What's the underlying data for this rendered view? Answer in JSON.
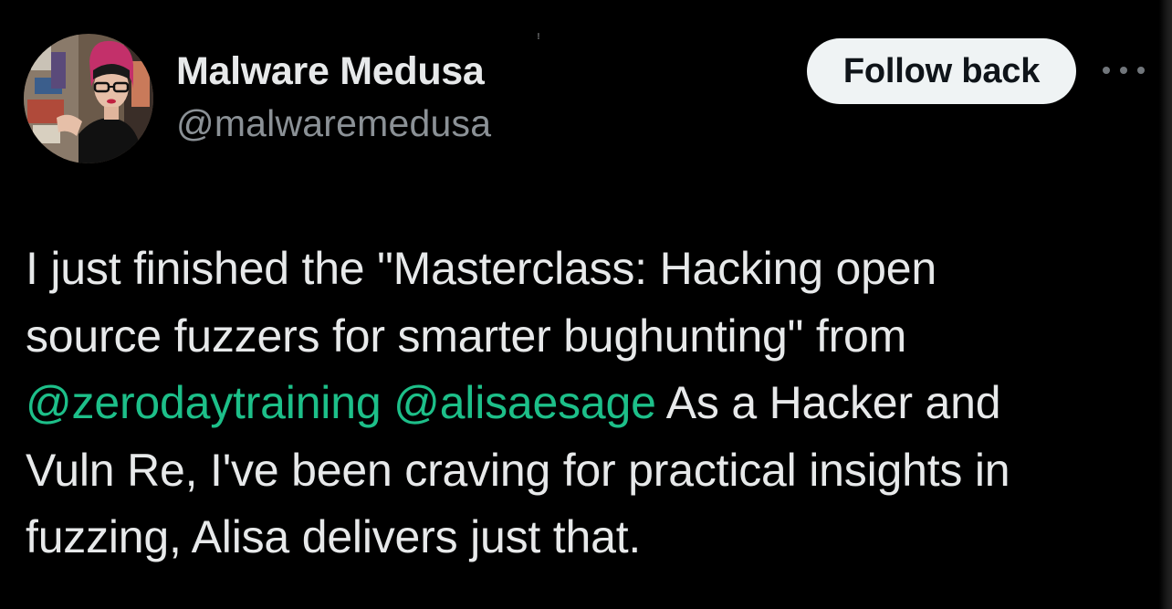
{
  "tweet": {
    "author": {
      "display_name": "Malware Medusa",
      "name_glyph": "⁝",
      "handle": "@malwaremedusa",
      "avatar_icon": "user-avatar-photo"
    },
    "follow_label": "Follow back",
    "more_icon": "more-horizontal-icon",
    "text": {
      "line1": "I just finished the \"Masterclass: Hacking open",
      "line2": "source fuzzers for smarter bughunting\" from",
      "mention1": "@zerodaytraining",
      "mention2": "@alisaesage",
      "line3_rest": " As a Hacker and",
      "line4": "Vuln Re, I've been craving for practical insights in",
      "line5": "fuzzing, Alisa delivers just that."
    }
  },
  "colors": {
    "background": "#000000",
    "text": "#e7e9ea",
    "secondary": "#8b9196",
    "mention": "#1dbf89",
    "button_bg": "#eff3f4",
    "button_text": "#0f1419"
  }
}
